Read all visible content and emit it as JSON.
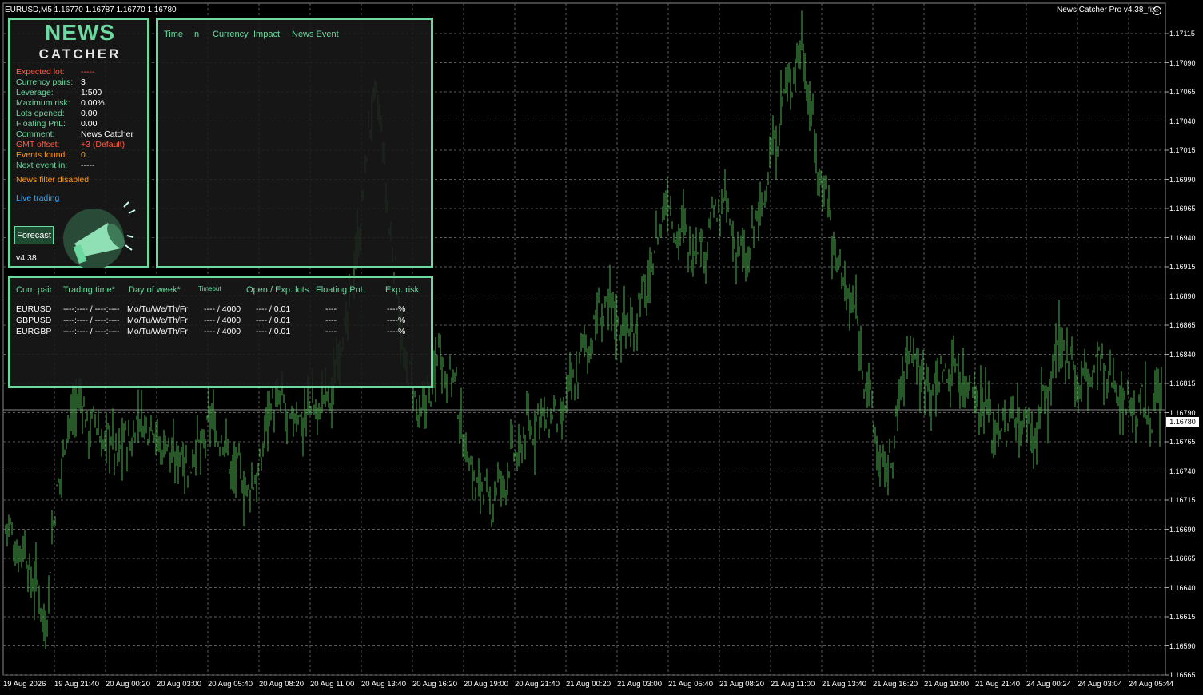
{
  "header": {
    "symbol_info": "EURUSD,M5  1.16770 1.16787 1.16770 1.16780",
    "ea_label": "News Catcher Pro v4.38_fix"
  },
  "price_axis": {
    "labels": [
      "1.17115",
      "1.17090",
      "1.17065",
      "1.17040",
      "1.17015",
      "1.16990",
      "1.16965",
      "1.16940",
      "1.16915",
      "1.16890",
      "1.16865",
      "1.16840",
      "1.16815",
      "1.16790",
      "1.16765",
      "1.16740",
      "1.16715",
      "1.16690",
      "1.16665",
      "1.16640",
      "1.16615",
      "1.16590",
      "1.16565"
    ],
    "current_price": "1.16780"
  },
  "time_axis": {
    "labels": [
      "19 Aug 2026",
      "19 Aug 21:40",
      "20 Aug 00:20",
      "20 Aug 03:00",
      "20 Aug 05:40",
      "20 Aug 08:20",
      "20 Aug 11:00",
      "20 Aug 13:40",
      "20 Aug 16:20",
      "20 Aug 19:00",
      "20 Aug 21:40",
      "21 Aug 00:20",
      "21 Aug 03:00",
      "21 Aug 05:40",
      "21 Aug 08:20",
      "21 Aug 11:00",
      "21 Aug 13:40",
      "21 Aug 16:20",
      "21 Aug 19:00",
      "21 Aug 21:40",
      "24 Aug 00:24",
      "24 Aug 03:04",
      "24 Aug 05:44"
    ]
  },
  "chart_data": {
    "type": "ohlc",
    "symbol": "EURUSD",
    "timeframe": "M5",
    "ylim": [
      1.16555,
      1.17125
    ],
    "bar_color": "#4caf50",
    "grid": true,
    "close_path": [
      [
        0,
        1.1668
      ],
      [
        0.02,
        1.1665
      ],
      [
        0.035,
        1.166
      ],
      [
        0.045,
        1.1672
      ],
      [
        0.06,
        1.1679
      ],
      [
        0.08,
        1.1676
      ],
      [
        0.1,
        1.16745
      ],
      [
        0.12,
        1.16775
      ],
      [
        0.14,
        1.16745
      ],
      [
        0.16,
        1.16735
      ],
      [
        0.18,
        1.1677
      ],
      [
        0.2,
        1.16725
      ],
      [
        0.215,
        1.1671
      ],
      [
        0.23,
        1.1679
      ],
      [
        0.25,
        1.1677
      ],
      [
        0.28,
        1.1679
      ],
      [
        0.3,
        1.1688
      ],
      [
        0.32,
        1.1706
      ],
      [
        0.33,
        1.1696
      ],
      [
        0.345,
        1.1682
      ],
      [
        0.36,
        1.1677
      ],
      [
        0.375,
        1.1683
      ],
      [
        0.39,
        1.16795
      ],
      [
        0.4,
        1.16735
      ],
      [
        0.41,
        1.16715
      ],
      [
        0.42,
        1.167
      ],
      [
        0.44,
        1.1674
      ],
      [
        0.46,
        1.16775
      ],
      [
        0.48,
        1.1677
      ],
      [
        0.49,
        1.168
      ],
      [
        0.5,
        1.1683
      ],
      [
        0.52,
        1.1687
      ],
      [
        0.54,
        1.16845
      ],
      [
        0.56,
        1.169
      ],
      [
        0.57,
        1.1696
      ],
      [
        0.58,
        1.16935
      ],
      [
        0.6,
        1.16915
      ],
      [
        0.62,
        1.16955
      ],
      [
        0.64,
        1.169
      ],
      [
        0.66,
        1.1698
      ],
      [
        0.675,
        1.1705
      ],
      [
        0.69,
        1.1709
      ],
      [
        0.7,
        1.17
      ],
      [
        0.71,
        1.1696
      ],
      [
        0.72,
        1.16905
      ],
      [
        0.735,
        1.1686
      ],
      [
        0.75,
        1.16775
      ],
      [
        0.76,
        1.1672
      ],
      [
        0.77,
        1.1676
      ],
      [
        0.78,
        1.16835
      ],
      [
        0.8,
        1.168
      ],
      [
        0.82,
        1.16815
      ],
      [
        0.84,
        1.16795
      ],
      [
        0.86,
        1.1676
      ],
      [
        0.875,
        1.16775
      ],
      [
        0.89,
        1.1676
      ],
      [
        0.9,
        1.1679
      ],
      [
        0.915,
        1.1684
      ],
      [
        0.93,
        1.168
      ],
      [
        0.945,
        1.1682
      ],
      [
        0.96,
        1.168
      ],
      [
        0.975,
        1.1678
      ],
      [
        1.0,
        1.1678
      ]
    ]
  },
  "logo": {
    "line1": "NEWS",
    "line2": "CATCHER"
  },
  "info": {
    "rows": [
      {
        "label": "Expected lot:",
        "value": "-----",
        "color": "#ff5a3c",
        "value_color": "#ff5a3c"
      },
      {
        "label": "Currency pairs:",
        "value": "3",
        "color": "#6bd9a0",
        "value_color": "#ffffff"
      },
      {
        "label": "Leverage:",
        "value": "1:500",
        "color": "#6bd9a0",
        "value_color": "#ffffff"
      },
      {
        "label": "Maximum risk:",
        "value": "0.00%",
        "color": "#6bd9a0",
        "value_color": "#ffffff"
      },
      {
        "label": "Lots opened:",
        "value": "0.00",
        "color": "#6bd9a0",
        "value_color": "#ffffff"
      },
      {
        "label": "Floating PnL:",
        "value": "0.00",
        "color": "#6bd9a0",
        "value_color": "#ffffff"
      },
      {
        "label": "Comment:",
        "value": "News Catcher",
        "color": "#6bd9a0",
        "value_color": "#ffffff"
      },
      {
        "label": "GMT offset:",
        "value": "+3 (Default)",
        "color": "#ff5a3c",
        "value_color": "#ff5a3c"
      },
      {
        "label": "Events found:",
        "value": "0",
        "color": "#ff9a1a",
        "value_color": "#ff9a1a"
      },
      {
        "label": "Next event in:",
        "value": "-----",
        "color": "#6bd9a0",
        "value_color": "#ffffff"
      }
    ],
    "news_filter": "News filter disabled",
    "live_trading": "Live trading",
    "forecast_button": "Forecast",
    "version": "v4.38"
  },
  "news_table": {
    "headers": {
      "time": "Time",
      "in": "In",
      "currency": "Currency",
      "impact": "Impact",
      "event": "News Event"
    }
  },
  "pairs_table": {
    "headers": {
      "pair": "Curr. pair",
      "trading_time": "Trading time*",
      "day_of_week": "Day of week*",
      "timeout": "Timeout",
      "open_lots": "Open / Exp. lots",
      "pnl": "Floating PnL",
      "risk": "Exp. risk"
    },
    "rows": [
      {
        "pair": "EURUSD",
        "trading_time": "----:---- / ----:----",
        "days": "Mo/Tu/We/Th/Fr",
        "timeout": "---- / 4000",
        "lots": "---- / 0.01",
        "pnl": "----",
        "risk": "----%"
      },
      {
        "pair": "GBPUSD",
        "trading_time": "----:---- / ----:----",
        "days": "Mo/Tu/We/Th/Fr",
        "timeout": "---- / 4000",
        "lots": "---- / 0.01",
        "pnl": "----",
        "risk": "----%"
      },
      {
        "pair": "EURGBP",
        "trading_time": "----:---- / ----:----",
        "days": "Mo/Tu/We/Th/Fr",
        "timeout": "---- / 4000",
        "lots": "---- / 0.01",
        "pnl": "----",
        "risk": "----%"
      }
    ]
  },
  "colors": {
    "accent": "#6bd9a0",
    "panel_bg": "#1a1a1a",
    "chart_bg": "#000000",
    "grid": "#5a5a5a"
  }
}
